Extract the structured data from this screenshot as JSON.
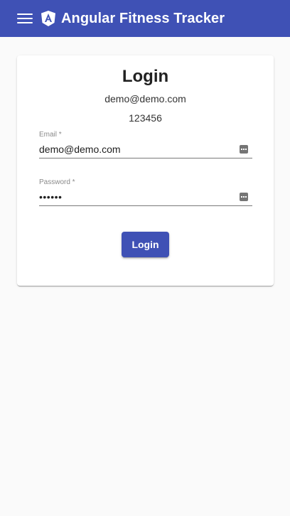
{
  "header": {
    "title": "Angular Fitness Tracker",
    "menu_icon": "hamburger-menu-icon",
    "logo_icon": "angular-shield-logo-icon",
    "background_color": "#3f51b5"
  },
  "login_card": {
    "title": "Login",
    "hint_email": "demo@demo.com",
    "hint_password": "123456",
    "email_field": {
      "label": "Email *",
      "value": "demo@demo.com",
      "icon": "password-manager-key-icon"
    },
    "password_field": {
      "label": "Password *",
      "masked_value": "••••••",
      "icon": "password-manager-key-icon"
    },
    "submit_label": "Login",
    "accent_color": "#3f51b5"
  }
}
